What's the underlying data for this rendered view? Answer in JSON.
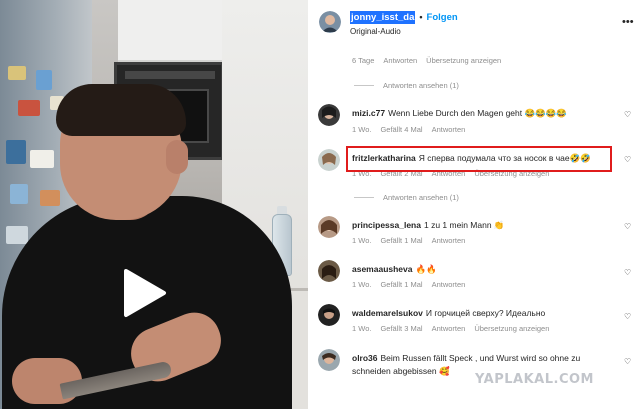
{
  "header": {
    "username": "jonny_isst_da",
    "separator": "•",
    "follow_label": "Folgen",
    "subtitle": "Original-Audio",
    "more_icon": "more-horizontal-icon"
  },
  "top_meta": {
    "time": "6 Tage",
    "reply": "Antworten",
    "translate": "Übersetzung anzeigen"
  },
  "view_replies_1": "Antworten ansehen (1)",
  "comments": [
    {
      "username": "mizi.c77",
      "text": "Wenn Liebe Durch den Magen geht 😂😂😂😂",
      "time": "1 Wo.",
      "likes": "Gefällt 4 Mal",
      "reply": "Antworten",
      "translate": ""
    },
    {
      "username": "fritzlerkatharina",
      "text": "Я сперва подумала что за носок в чае🤣🤣",
      "time": "1 Wo.",
      "likes": "Gefällt 2 Mal",
      "reply": "Antworten",
      "translate": "Übersetzung anzeigen"
    },
    {
      "username": "principessa_lena",
      "text": "1 zu 1 mein Mann 👏",
      "time": "1 Wo.",
      "likes": "Gefällt 1 Mal",
      "reply": "Antworten",
      "translate": ""
    },
    {
      "username": "asemaausheva",
      "text": "🔥🔥",
      "time": "1 Wo.",
      "likes": "Gefällt 1 Mal",
      "reply": "Antworten",
      "translate": ""
    },
    {
      "username": "waldemarelsukov",
      "text": "И горчицей сверху? Идеально",
      "time": "1 Wo.",
      "likes": "Gefällt 3 Mal",
      "reply": "Antworten",
      "translate": "Übersetzung anzeigen"
    },
    {
      "username": "olro36",
      "text": "Beim Russen fällt Speck , und Wurst wird so ohne zu schneiden abgebissen 🥰",
      "time": "",
      "likes": "",
      "reply": "",
      "translate": ""
    }
  ],
  "view_replies_2": "Antworten ansehen (1)",
  "watermark": "YAPLAKAL.COM",
  "colors": {
    "follow": "#0095f6",
    "selection": "#1f72ff",
    "highlight_border": "#e01c1c",
    "muted_text": "#8e8e8e"
  }
}
